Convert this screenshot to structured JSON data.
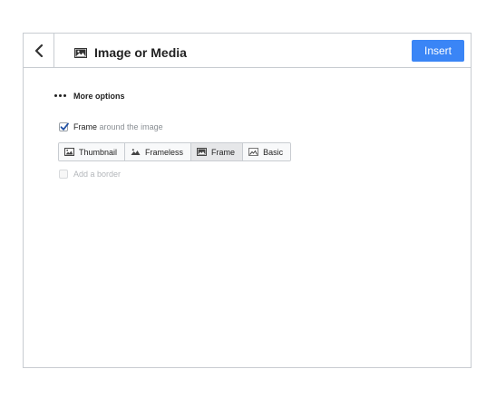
{
  "header": {
    "back_icon": "chevron-left-icon",
    "title_icon": "image-icon",
    "title": "Image or Media",
    "insert_label": "Insert",
    "insert_color": "#3a85f6"
  },
  "options": {
    "more_options_label": "More options",
    "frame": {
      "checked": true,
      "label_strong": "Frame",
      "label_muted": "around the image"
    },
    "styles": [
      {
        "label": "Thumbnail",
        "icon": "image-icon",
        "active": false
      },
      {
        "label": "Frameless",
        "icon": "image-icon",
        "active": false
      },
      {
        "label": "Frame",
        "icon": "image-icon",
        "active": true
      },
      {
        "label": "Basic",
        "icon": "image-icon",
        "active": false
      }
    ],
    "border": {
      "checked": false,
      "disabled": true,
      "label": "Add a border"
    }
  }
}
